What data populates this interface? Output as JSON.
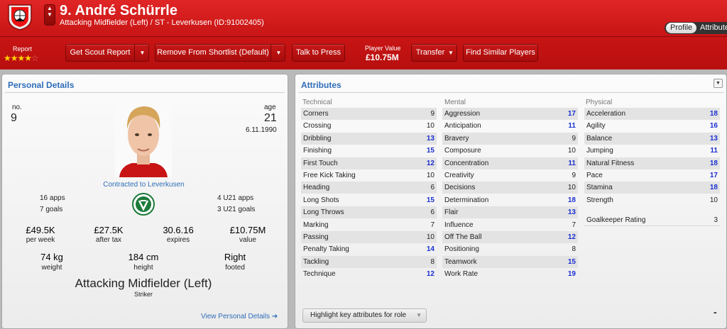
{
  "header": {
    "player_name": "9. André Schürrle",
    "player_sub": "Attacking Midfielder (Left) / ST - Leverkusen (ID:91002405)",
    "nav_arrows": "▲▼",
    "view_profile": "Profile",
    "view_attributes": "Attributes"
  },
  "toolbar": {
    "report_label": "Report",
    "stars_filled": "★★★★",
    "stars_empty": "☆",
    "scout_report": "Get Scout Report",
    "remove_shortlist": "Remove From Shortlist (Default)",
    "talk_press": "Talk to Press",
    "player_value_label": "Player Value",
    "player_value": "£10.75M",
    "transfer": "Transfer",
    "similar": "Find Similar Players",
    "drop_glyph": "▼"
  },
  "personal": {
    "title": "Personal Details",
    "no_label": "no.",
    "no_value": "9",
    "age_label": "age",
    "age_value": "21",
    "dob": "6.11.1990",
    "contract": "Contracted to Leverkusen",
    "apps": "16 apps",
    "goals": "7 goals",
    "u21_apps": "4 U21 apps",
    "u21_goals": "3 U21 goals",
    "wage": "£49.5K",
    "wage_label": "per week",
    "after_tax": "£27.5K",
    "after_tax_label": "after tax",
    "expires": "30.6.16",
    "expires_label": "expires",
    "value": "£10.75M",
    "value_label": "value",
    "weight": "74 kg",
    "weight_label": "weight",
    "height": "184 cm",
    "height_label": "height",
    "footed": "Right",
    "footed_label": "footed",
    "position": "Attacking Midfielder (Left)",
    "position_sub": "Striker",
    "view_link": "View Personal Details ➔"
  },
  "attributes": {
    "title": "Attributes",
    "technical_label": "Technical",
    "mental_label": "Mental",
    "physical_label": "Physical",
    "technical": [
      {
        "name": "Corners",
        "value": "9"
      },
      {
        "name": "Crossing",
        "value": "10"
      },
      {
        "name": "Dribbling",
        "value": "13"
      },
      {
        "name": "Finishing",
        "value": "15"
      },
      {
        "name": "First Touch",
        "value": "12"
      },
      {
        "name": "Free Kick Taking",
        "value": "10"
      },
      {
        "name": "Heading",
        "value": "6"
      },
      {
        "name": "Long Shots",
        "value": "15"
      },
      {
        "name": "Long Throws",
        "value": "6"
      },
      {
        "name": "Marking",
        "value": "7"
      },
      {
        "name": "Passing",
        "value": "10"
      },
      {
        "name": "Penalty Taking",
        "value": "14"
      },
      {
        "name": "Tackling",
        "value": "8"
      },
      {
        "name": "Technique",
        "value": "12"
      }
    ],
    "mental": [
      {
        "name": "Aggression",
        "value": "17"
      },
      {
        "name": "Anticipation",
        "value": "11"
      },
      {
        "name": "Bravery",
        "value": "9"
      },
      {
        "name": "Composure",
        "value": "10"
      },
      {
        "name": "Concentration",
        "value": "11"
      },
      {
        "name": "Creativity",
        "value": "9"
      },
      {
        "name": "Decisions",
        "value": "10"
      },
      {
        "name": "Determination",
        "value": "18"
      },
      {
        "name": "Flair",
        "value": "13"
      },
      {
        "name": "Influence",
        "value": "7"
      },
      {
        "name": "Off The Ball",
        "value": "12"
      },
      {
        "name": "Positioning",
        "value": "8"
      },
      {
        "name": "Teamwork",
        "value": "15"
      },
      {
        "name": "Work Rate",
        "value": "19"
      }
    ],
    "physical": [
      {
        "name": "Acceleration",
        "value": "18"
      },
      {
        "name": "Agility",
        "value": "16"
      },
      {
        "name": "Balance",
        "value": "13"
      },
      {
        "name": "Jumping",
        "value": "11"
      },
      {
        "name": "Natural Fitness",
        "value": "18"
      },
      {
        "name": "Pace",
        "value": "17"
      },
      {
        "name": "Stamina",
        "value": "18"
      },
      {
        "name": "Strength",
        "value": "10"
      }
    ],
    "goalkeeper_label": "Goalkeeper Rating",
    "goalkeeper_value": "3",
    "highlight_select": "Highlight key attributes for role",
    "menu_glyph": "▼",
    "dash": "-"
  }
}
